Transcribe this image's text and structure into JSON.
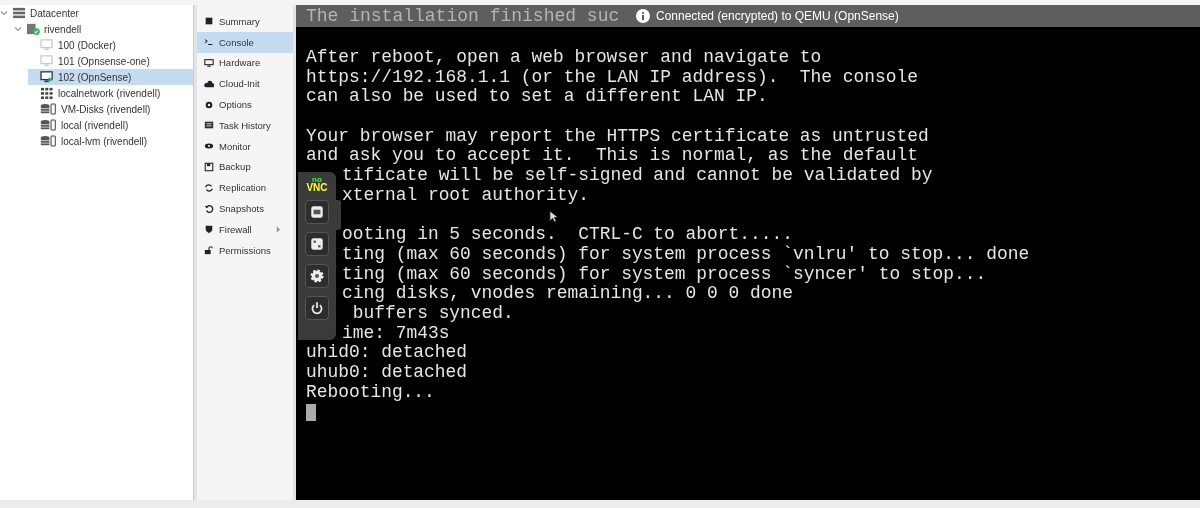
{
  "tree": [
    {
      "label": "Datacenter",
      "kind": "datacenter",
      "expanded": true,
      "selected": false,
      "children": [
        {
          "label": "rivendell",
          "kind": "node",
          "expanded": true,
          "selected": false,
          "children": [
            {
              "label": "100 (Docker)",
              "kind": "vm",
              "running": false,
              "selected": false
            },
            {
              "label": "101 (Opnsense-one)",
              "kind": "vm",
              "running": false,
              "selected": false
            },
            {
              "label": "102 (OpnSense)",
              "kind": "vm",
              "running": true,
              "selected": true
            },
            {
              "label": "localnetwork (rivendell)",
              "kind": "network",
              "selected": false
            },
            {
              "label": "VM-Disks (rivendell)",
              "kind": "storage",
              "selected": false
            },
            {
              "label": "local (rivendell)",
              "kind": "storage",
              "selected": false
            },
            {
              "label": "local-lvm (rivendell)",
              "kind": "storage",
              "selected": false
            }
          ]
        }
      ]
    }
  ],
  "menu": [
    {
      "label": "Summary",
      "selected": false
    },
    {
      "label": "Console",
      "selected": true
    },
    {
      "label": "Hardware",
      "selected": false
    },
    {
      "label": "Cloud-Init",
      "selected": false
    },
    {
      "label": "Options",
      "selected": false
    },
    {
      "label": "Task History",
      "selected": false
    },
    {
      "label": "Monitor",
      "selected": false
    },
    {
      "label": "Backup",
      "selected": false
    },
    {
      "label": "Replication",
      "selected": false
    },
    {
      "label": "Snapshots",
      "selected": false
    },
    {
      "label": "Firewall",
      "selected": false,
      "has_submenu": true
    },
    {
      "label": "Permissions",
      "selected": false
    }
  ],
  "console": {
    "banner": "Connected (encrypted) to QEMU (OpnSense)",
    "faded_line": "The installation finished suc",
    "lines": [
      {
        "kind": "full",
        "text": "After reboot, open a web browser and navigate to"
      },
      {
        "kind": "full",
        "text": "https://192.168.1.1 (or the LAN IP address).  The console"
      },
      {
        "kind": "full",
        "text": "can also be used to set a different LAN IP."
      },
      {
        "kind": "blank"
      },
      {
        "kind": "full",
        "text": "Your browser may report the HTTPS certificate as untrusted"
      },
      {
        "kind": "full",
        "text": "and ask you to accept it.  This is normal, as the default"
      },
      {
        "kind": "cut",
        "text": "tificate will be self-signed and cannot be validated by"
      },
      {
        "kind": "cut",
        "text": "xternal root authority."
      },
      {
        "kind": "blank"
      },
      {
        "kind": "cut",
        "text": "ooting in 5 seconds.  CTRL-C to abort....."
      },
      {
        "kind": "cut",
        "text": "ting (max 60 seconds) for system process `vnlru' to stop... done"
      },
      {
        "kind": "cut",
        "text": "ting (max 60 seconds) for system process `syncer' to stop..."
      },
      {
        "kind": "cut",
        "text": "cing disks, vnodes remaining... 0 0 0 done"
      },
      {
        "kind": "cut",
        "text": " buffers synced."
      },
      {
        "kind": "cut",
        "text": "ime: 7m43s"
      },
      {
        "kind": "full",
        "text": "uhid0: detached"
      },
      {
        "kind": "full",
        "text": "uhub0: detached"
      },
      {
        "kind": "full",
        "text": "Rebooting..."
      }
    ],
    "vnc_logo_top": "no",
    "vnc_logo_bottom": "VNC"
  }
}
